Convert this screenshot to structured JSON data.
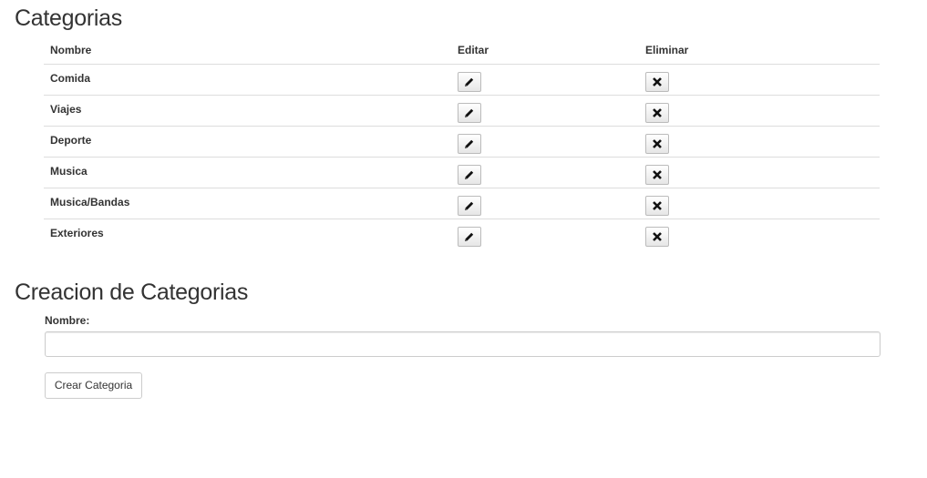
{
  "categories_section": {
    "title": "Categorias",
    "columns": {
      "name": "Nombre",
      "edit": "Editar",
      "delete": "Eliminar"
    },
    "rows": [
      {
        "name": "Comida"
      },
      {
        "name": "Viajes"
      },
      {
        "name": "Deporte"
      },
      {
        "name": "Musica"
      },
      {
        "name": "Musica/Bandas"
      },
      {
        "name": "Exteriores"
      }
    ]
  },
  "create_section": {
    "title": "Creacion de Categorias",
    "name_label": "Nombre:",
    "name_value": "",
    "name_placeholder": "",
    "submit_label": "Crear Categoria"
  },
  "icons": {
    "edit": "pencil-icon",
    "delete": "remove-icon"
  }
}
